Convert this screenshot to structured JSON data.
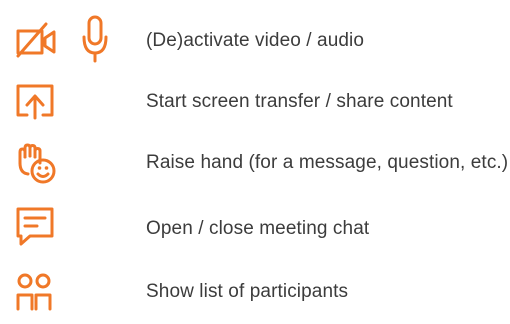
{
  "theme": {
    "icon_color": "#f07828",
    "text_color": "#3c3c3c",
    "background": "#ffffff"
  },
  "items": [
    {
      "icons": [
        "video-off-icon",
        "microphone-icon"
      ],
      "label": "(De)activate video / audio"
    },
    {
      "icons": [
        "screen-share-icon"
      ],
      "label": "Start screen transfer / share content"
    },
    {
      "icons": [
        "raise-hand-icon"
      ],
      "label": "Raise hand (for a message, question, etc.)"
    },
    {
      "icons": [
        "chat-icon"
      ],
      "label": "Open / close meeting chat"
    },
    {
      "icons": [
        "participants-icon"
      ],
      "label": "Show list of participants"
    }
  ]
}
